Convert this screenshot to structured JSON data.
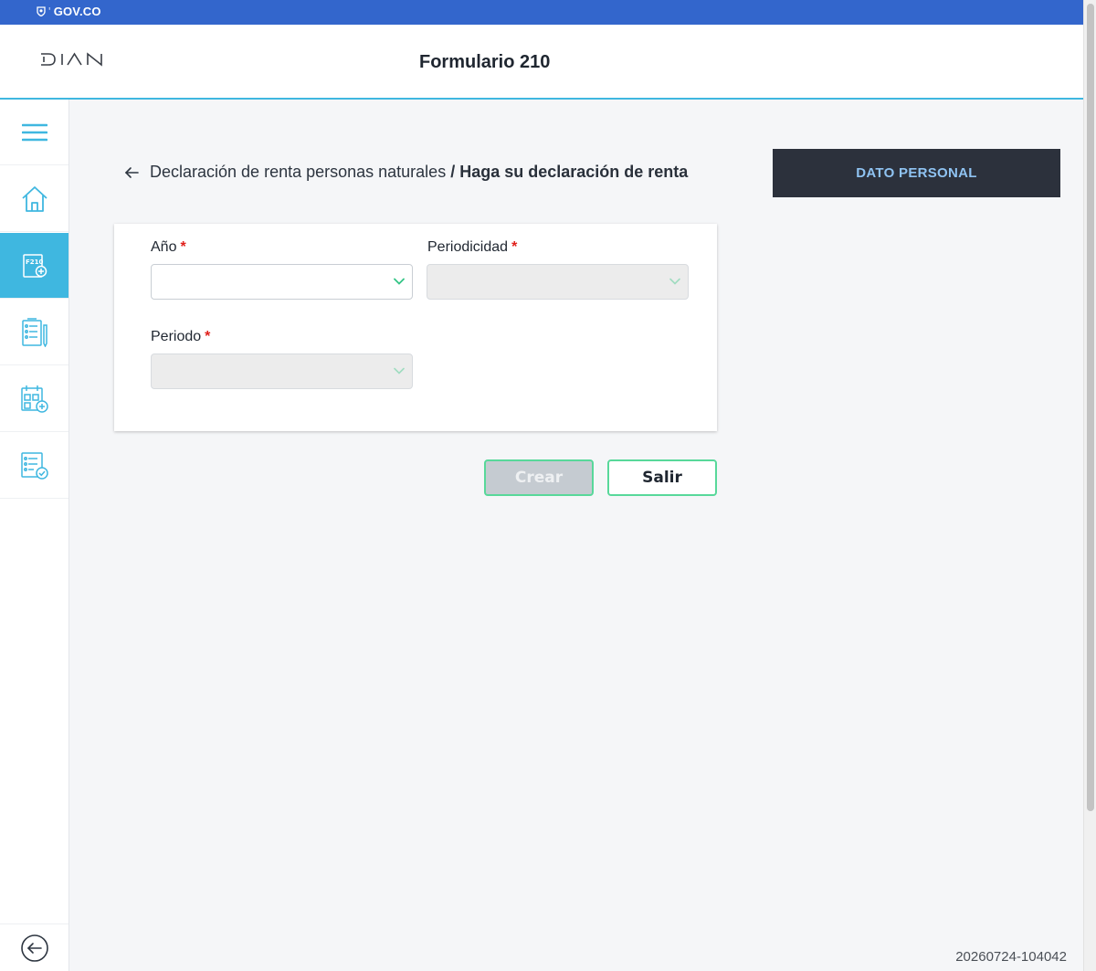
{
  "govbar": {
    "label": "GOV.CO"
  },
  "header": {
    "logo_text": "DIAN",
    "title": "Formulario 210"
  },
  "sidebar": {
    "items": [
      {
        "name": "menu",
        "icon": "hamburger-menu-icon"
      },
      {
        "name": "home",
        "icon": "home-icon"
      },
      {
        "name": "f210",
        "icon": "form-f210-add-icon",
        "badge": "F210",
        "active": true
      },
      {
        "name": "form-list",
        "icon": "form-list-edit-icon"
      },
      {
        "name": "calendar",
        "icon": "calendar-add-icon"
      },
      {
        "name": "checklist",
        "icon": "checklist-approved-icon"
      }
    ],
    "back_icon": "back-circle-icon"
  },
  "breadcrumb": {
    "parent": "Declaración de renta personas naturales",
    "separator": "/",
    "current": "Haga su declaración de renta"
  },
  "personal_button": {
    "label": "DATO PERSONAL"
  },
  "form": {
    "fields": [
      {
        "label": "Año",
        "required_mark": "*",
        "value": "",
        "disabled": false
      },
      {
        "label": "Periodicidad",
        "required_mark": "*",
        "value": "",
        "disabled": true
      },
      {
        "label": "Periodo",
        "required_mark": "*",
        "value": "",
        "disabled": true
      }
    ]
  },
  "actions": {
    "create_label": "Crear",
    "exit_label": "Salir"
  },
  "build_id": "20260724-104042",
  "colors": {
    "gov_blue": "#3366cc",
    "accent_cyan": "#3fb7e0",
    "button_border_green": "#58d89a",
    "dark_panel": "#2c313c",
    "required_red": "#e0201b"
  }
}
